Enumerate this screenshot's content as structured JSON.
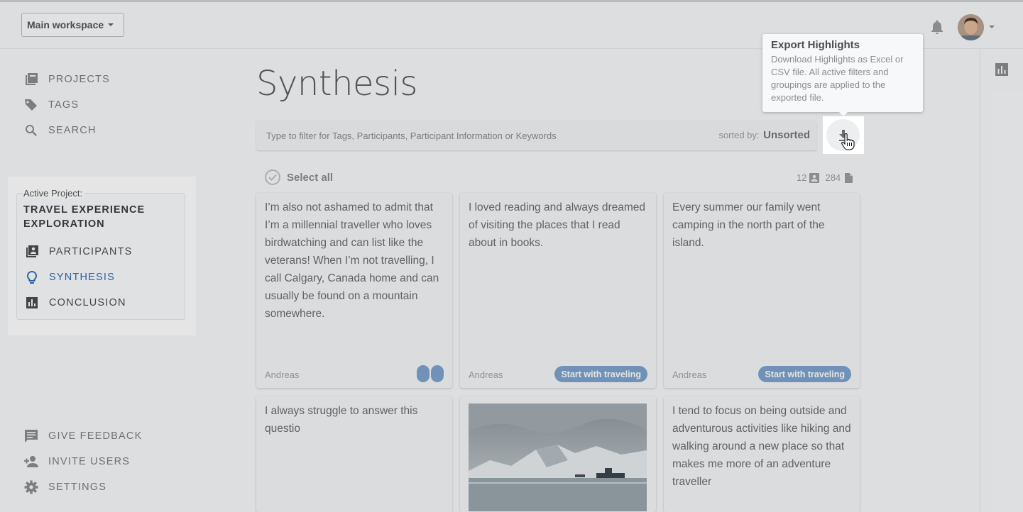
{
  "workspace": {
    "label": "Main workspace"
  },
  "nav": {
    "projects": "PROJECTS",
    "tags": "TAGS",
    "search": "SEARCH"
  },
  "active_project": {
    "label": "Active Project:",
    "name": "TRAVEL EXPERIENCE EXPLORATION",
    "items": [
      "PARTICIPANTS",
      "SYNTHESIS",
      "CONCLUSION"
    ]
  },
  "bottom_nav": {
    "feedback": "GIVE FEEDBACK",
    "invite": "INVITE USERS",
    "settings": "SETTINGS"
  },
  "main": {
    "title": "Synthesis",
    "filter_placeholder": "Type to filter for Tags, Participants, Participant Information or Keywords",
    "sorted_label": "sorted by:",
    "sorted_value": "Unsorted",
    "select_all": "Select all",
    "participant_count": "12",
    "highlight_count": "284"
  },
  "tooltip": {
    "title": "Export Highlights",
    "body": "Download Highlights as Excel or CSV file. All active filters and groupings are applied to the exported file."
  },
  "cards": [
    {
      "text": "I’m also not ashamed to admit that I’m a millennial traveller who loves birdwatching and can list like the veterans! When I’m not travelling, I call Calgary, Canada home and can usually be found on a mountain somewhere.",
      "author": "Andreas"
    },
    {
      "text": "I loved reading and always dreamed of visiting the places that I read about in books.",
      "author": "Andreas",
      "tag": "Start with traveling"
    },
    {
      "text": "Every summer our family went camping in the north part of the island.",
      "author": "Andreas",
      "tag": "Start with traveling"
    },
    {
      "text": "I always struggle to answer this questio"
    },
    {
      "text": "I tend to focus on being outside and adventurous activities like hiking and walking around a new place so that makes me more of an adventure traveller"
    }
  ],
  "colors": {
    "accent": "#2f6db5",
    "tag": "#7ea3cd"
  }
}
